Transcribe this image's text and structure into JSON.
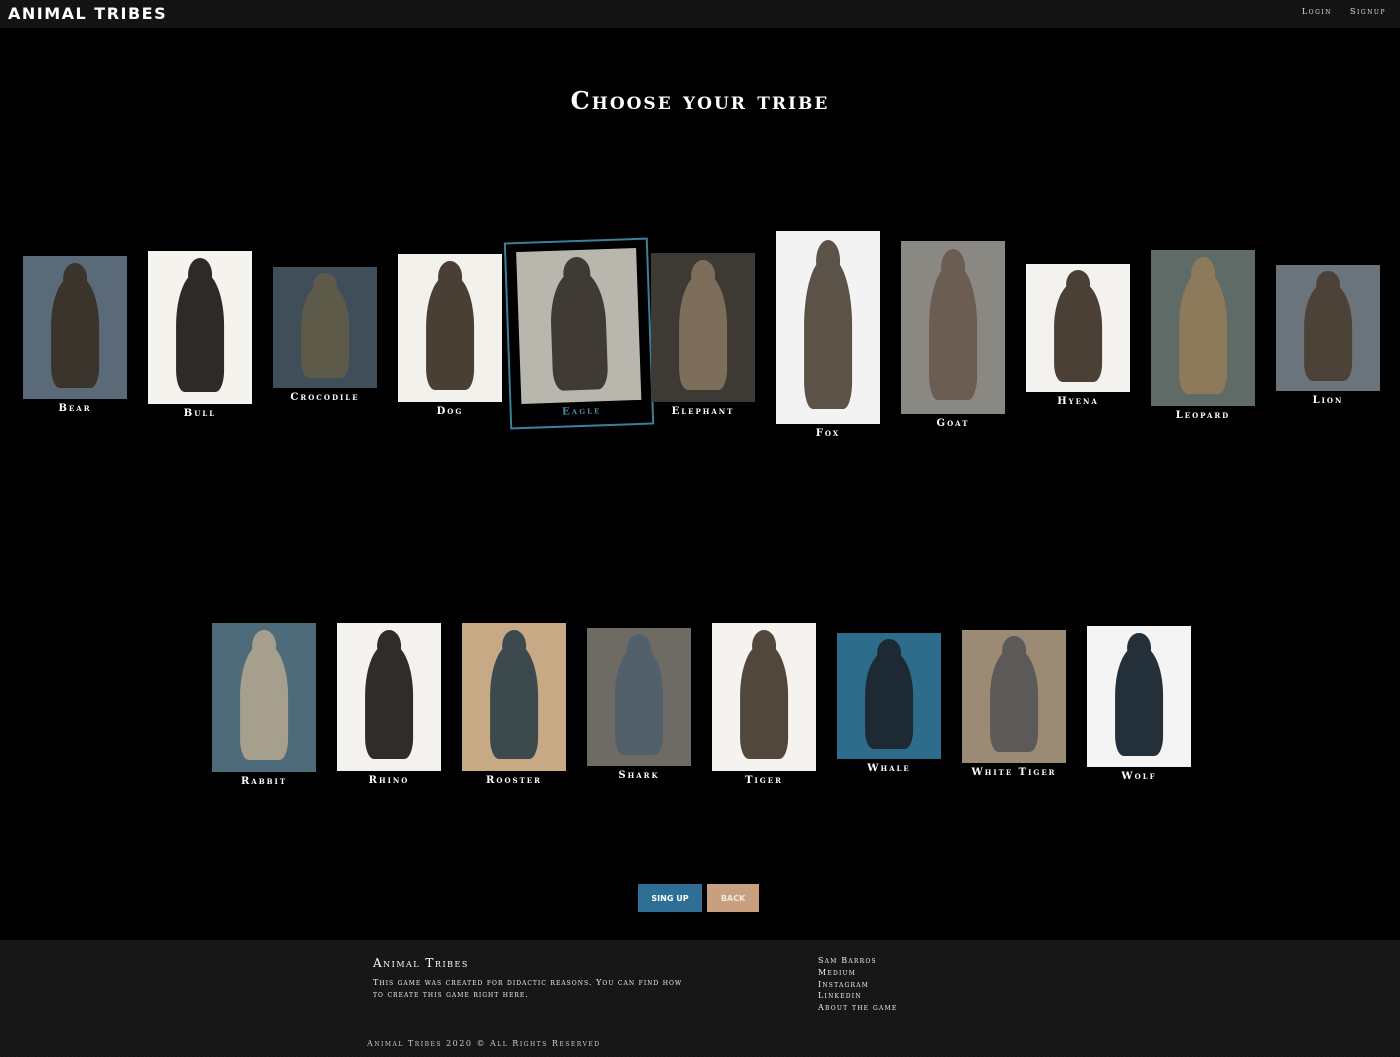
{
  "header": {
    "brand": "ANIMAL TRIBES",
    "nav": [
      "Login",
      "Signup"
    ]
  },
  "page_title": "Choose your tribe",
  "tribes": [
    {
      "name": "Bear",
      "bg": "#5a6a78",
      "fg": "#3b342c"
    },
    {
      "name": "Bull",
      "bg": "#f5f3ee",
      "fg": "#2d2a27"
    },
    {
      "name": "Crocodile",
      "bg": "#3f4e58",
      "fg": "#5d5a4a"
    },
    {
      "name": "Dog",
      "bg": "#f3f1ec",
      "fg": "#4a3f34"
    },
    {
      "name": "Eagle",
      "bg": "#b9b6ae",
      "fg": "#3f3a36"
    },
    {
      "name": "Elephant",
      "bg": "#3d3a34",
      "fg": "#7c6e5b"
    },
    {
      "name": "Fox",
      "bg": "#f2f3f2",
      "fg": "#5b5248"
    },
    {
      "name": "Goat",
      "bg": "#8a8883",
      "fg": "#6b5d52"
    },
    {
      "name": "Hyena",
      "bg": "#f4f2ee",
      "fg": "#4b4036"
    },
    {
      "name": "Leopard",
      "bg": "#5f6b66",
      "fg": "#8d7a5a"
    },
    {
      "name": "Lion",
      "bg": "#6c747b",
      "fg": "#4d4237"
    },
    {
      "name": "Rabbit",
      "bg": "#4e6b7a",
      "fg": "#a79f8e"
    },
    {
      "name": "Rhino",
      "bg": "#f4f2ef",
      "fg": "#2f2c2a"
    },
    {
      "name": "Rooster",
      "bg": "#c8a985",
      "fg": "#3c4a4e"
    },
    {
      "name": "Shark",
      "bg": "#6d6b63",
      "fg": "#51606a"
    },
    {
      "name": "Tiger",
      "bg": "#f4f3ef",
      "fg": "#51473a"
    },
    {
      "name": "Whale",
      "bg": "#2e6c8c",
      "fg": "#1d2a33"
    },
    {
      "name": "White Tiger",
      "bg": "#9b8a74",
      "fg": "#5c5a58"
    },
    {
      "name": "Wolf",
      "bg": "#f3f4f3",
      "fg": "#23303a"
    }
  ],
  "buttons": {
    "signup": "SING UP",
    "back": "BACK"
  },
  "footer": {
    "title": "Animal Tribes",
    "desc": "This game was created for didactic reasons. You can find how to create this game right here.",
    "links": [
      "Sam Barros",
      "Medium",
      "Instagram",
      "Linkedin",
      "About the game"
    ],
    "copyright": "Animal Tribes 2020 © All Rights Reserved"
  }
}
